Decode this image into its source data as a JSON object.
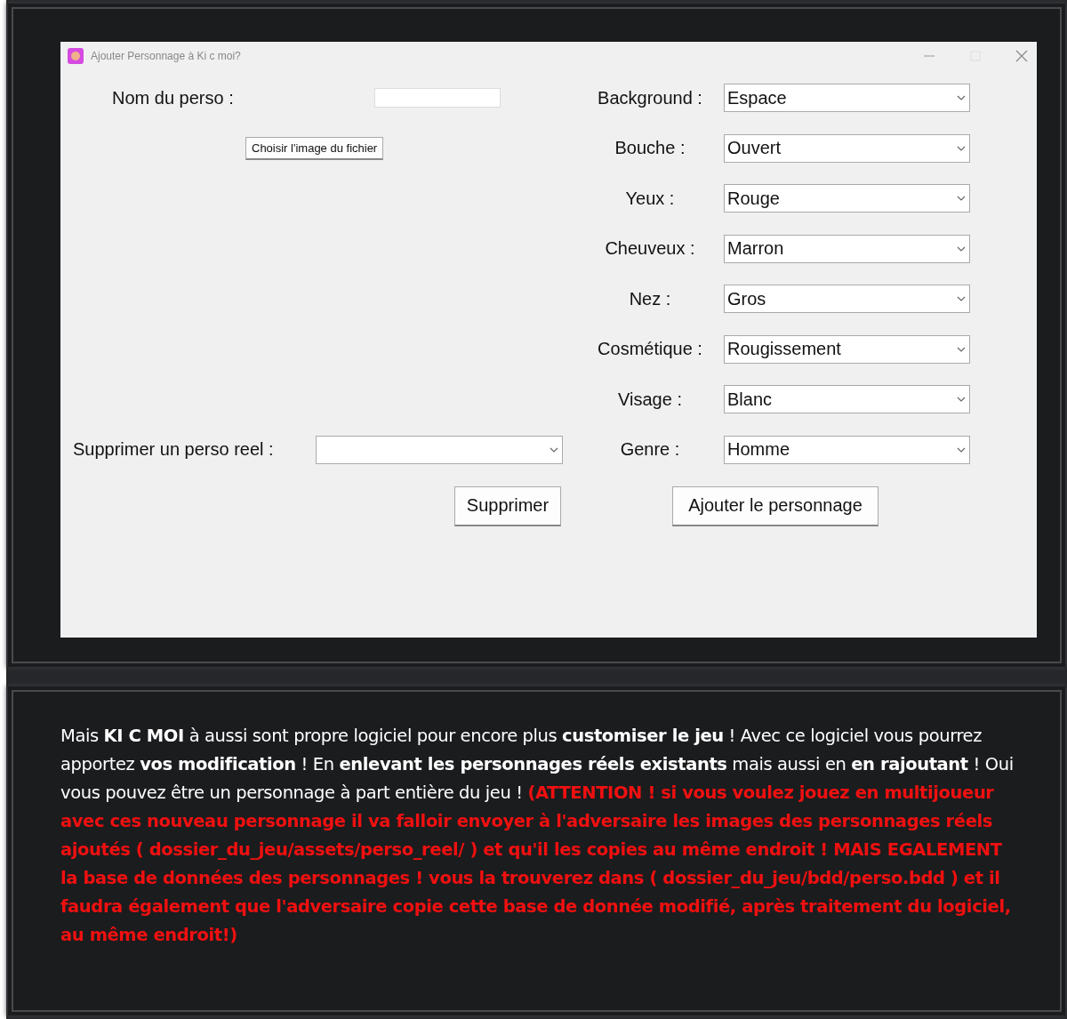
{
  "window": {
    "title": "Ajouter Personnage à Ki c moi?"
  },
  "name_field": {
    "label": "Nom du perso :"
  },
  "choose_image_button": "Choisir l'image du fichier",
  "attributes": [
    {
      "label": "Background :",
      "value": "Espace"
    },
    {
      "label": "Bouche :",
      "value": "Ouvert"
    },
    {
      "label": "Yeux :",
      "value": "Rouge"
    },
    {
      "label": "Cheuveux :",
      "value": "Marron"
    },
    {
      "label": "Nez :",
      "value": "Gros"
    },
    {
      "label": "Cosmétique :",
      "value": "Rougissement"
    },
    {
      "label": "Visage :",
      "value": "Blanc"
    },
    {
      "label": "Genre :",
      "value": "Homme"
    }
  ],
  "delete_field": {
    "label": "Supprimer un perso reel :"
  },
  "delete_button": "Supprimer",
  "add_button": "Ajouter le personnage",
  "description": {
    "text": "Mais **KI C MOI** à aussi sont propre logiciel pour encore plus **customiser le jeu** ! Avec ce logiciel vous pourrez apportez **vos modification** ! En **enlevant les personnages réels existants** mais aussi en **en rajoutant** ! Oui vous pouvez être un personnage à part entière du jeu !",
    "warning": "(ATTENTION ! si vous voulez jouez en multijoueur avec ces nouveau personnage il va falloir envoyer à l'adversaire les images des personnages réels ajoutés ( dossier_du_jeu/assets/perso_reel/ ) et qu'il les copies au même endroit ! MAIS EGALEMENT la base de données des personnages ! vous la trouverez dans ( dossier_du_jeu/bdd/perso.bdd ) et il faudra également que l'adversaire copie cette base de donnée modifié, après traitement du logiciel, au même endroit!)"
  }
}
